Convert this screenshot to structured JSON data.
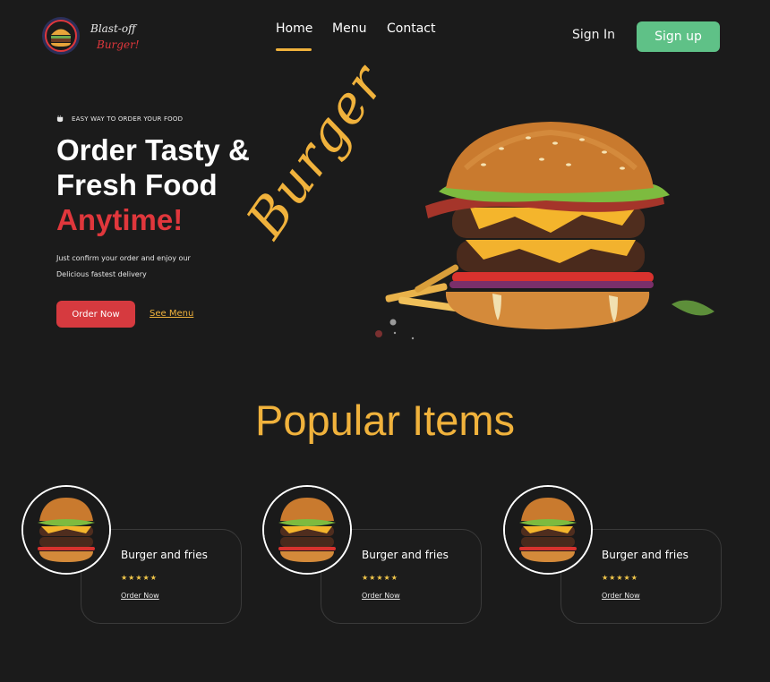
{
  "header": {
    "logo_line1": "Blast-off",
    "logo_line2": "Burger!",
    "nav": [
      {
        "label": "Home",
        "active": true
      },
      {
        "label": "Menu"
      },
      {
        "label": "Contact"
      }
    ],
    "sign_in": "Sign In",
    "sign_up": "Sign up"
  },
  "hero": {
    "eyebrow": "EASY WAY TO ORDER YOUR FOOD",
    "title_line1": "Order Tasty &",
    "title_line2": "Fresh Food",
    "title_accent": "Anytime!",
    "desc_line1": "Just confirm your order and enjoy our",
    "desc_line2": "Delicious fastest delivery",
    "order_button": "Order Now",
    "see_menu": "See Menu",
    "script_word": "Burger"
  },
  "popular": {
    "title": "Popular Items",
    "items": [
      {
        "name": "Burger and fries",
        "rating": "★★★★★",
        "link": "Order Now"
      },
      {
        "name": "Burger and fries",
        "rating": "★★★★★",
        "link": "Order Now"
      },
      {
        "name": "Burger and fries",
        "rating": "★★★★★",
        "link": "Order Now"
      }
    ]
  },
  "colors": {
    "background": "#1b1b1b",
    "accent_gold": "#f0b23c",
    "accent_red": "#e0373c",
    "signup_green": "#5fc187"
  },
  "icons": [
    "burger-logo-icon",
    "coffee-cup-icon"
  ]
}
